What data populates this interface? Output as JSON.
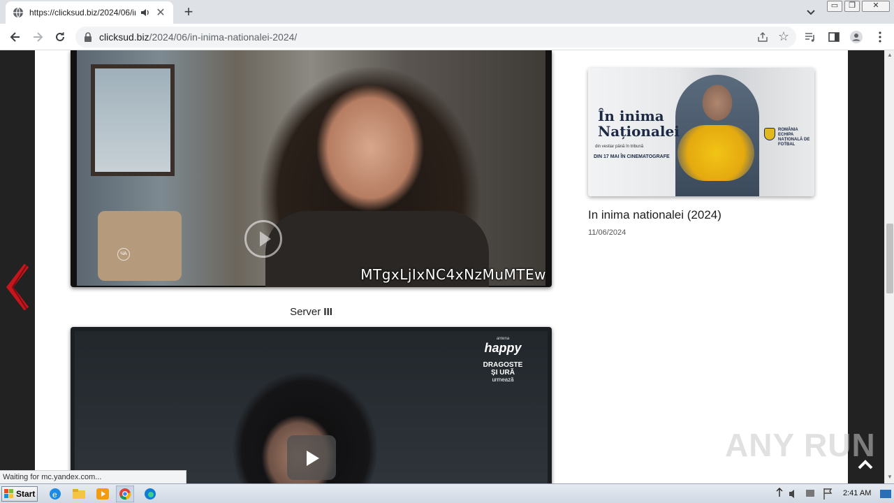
{
  "browser": {
    "tab_title": "https://clicksud.biz/2024/06/in-i",
    "tab_close": "✕",
    "new_tab": "+",
    "url_host": "clicksud.biz",
    "url_path": "/2024/06/in-inima-nationalei-2024/",
    "star": "☆"
  },
  "window_controls": {
    "minimize": "▭",
    "restore": "❐",
    "close": "✕"
  },
  "player1": {
    "overlay_code": "MTgxLjIxNC4xNzMuMTEw",
    "channel_logo": "ЧА"
  },
  "server3": {
    "prefix": "Server ",
    "numeral": "III"
  },
  "player2": {
    "channel_top": "antena",
    "brand": "happy",
    "show_line1": "DRAGOSTE",
    "show_line2": "ȘI URĂ",
    "show_line3": "urmează"
  },
  "sidebar": {
    "poster": {
      "title_line1": "În inima",
      "title_line2": "Naționalei",
      "tagline": "din vestiar până în tribună",
      "premiere": "DIN 17 MAI ÎN CINEMATOGRAFE",
      "federation": "ROMÂNIA ECHIPA NAȚIONALĂ DE FOTBAL"
    },
    "post_title": "In inima nationalei (2024)",
    "post_date": "11/06/2024"
  },
  "watermark": "ANY RUN",
  "status_text": "Waiting for mc.yandex.com...",
  "taskbar": {
    "start_label": "Start",
    "clock": "2:41 AM"
  },
  "colors": {
    "page_side": "#222222",
    "accent_red": "#c4161c",
    "tab_strip": "#dee1e6"
  }
}
